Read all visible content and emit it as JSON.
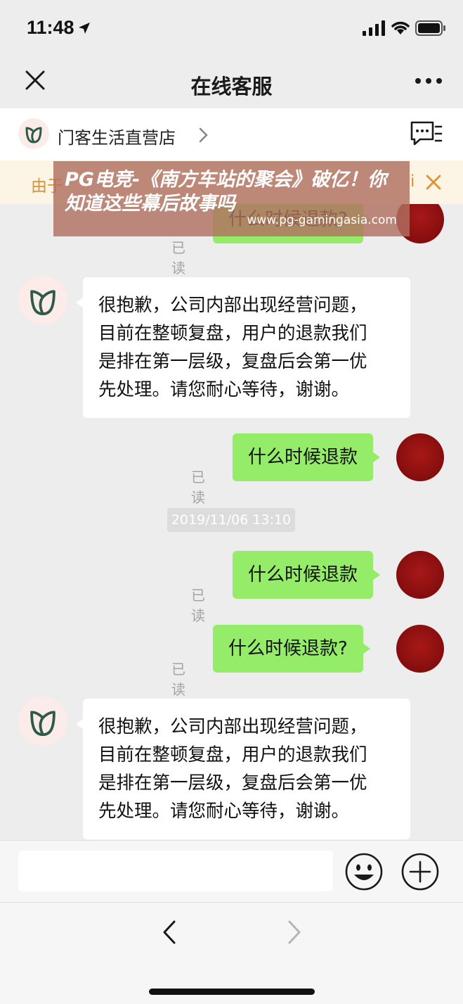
{
  "status_bar": {
    "time": "11:48"
  },
  "nav": {
    "title": "在线客服"
  },
  "shop": {
    "name": "门客生活直营店"
  },
  "notice": {
    "text_start": "由于",
    "text_end": "i"
  },
  "watermark": {
    "title": "PG电竞-《南方车站的聚会》破亿！你知道这些幕后故事吗",
    "url": "www.pg-gamingasia.com"
  },
  "chat": {
    "read_label": "已读",
    "timestamp": "2019/11/06 13:10",
    "messages": [
      {
        "from": "user",
        "text": "什么时候退款?",
        "read": "已读"
      },
      {
        "from": "shop",
        "text": "很抱歉，公司内部出现经营问题，目前在整顿复盘，用户的退款我们是排在第一层级，复盘后会第一优先处理。请您耐心等待，谢谢。"
      },
      {
        "from": "user",
        "text": "什么时候退款",
        "read": "已读"
      },
      {
        "from": "user",
        "text": "什么时候退款",
        "read": "已读"
      },
      {
        "from": "user",
        "text": "什么时候退款?",
        "read": "已读"
      },
      {
        "from": "shop",
        "text": "很抱歉，公司内部出现经营问题，目前在整顿复盘，用户的退款我们是排在第一层级，复盘后会第一优先处理。请您耐心等待，谢谢。"
      }
    ],
    "shop_lines": [
      "很抱歉，公司内部出现经营问题，",
      "目前在整顿复盘，用户的退款我们",
      "是排在第一层级，复盘后会第一优",
      "先处理。请您耐心等待，谢谢。"
    ]
  },
  "input": {
    "placeholder": ""
  },
  "colors": {
    "background": "#ededed",
    "bubble_out": "#95ec69",
    "bubble_in": "#ffffff",
    "notice_text": "#e0922e",
    "brand_green": "#2f5a47"
  },
  "icons": {
    "close": "close-icon",
    "more": "more-icon",
    "chevron": "chevron-right-icon",
    "service": "customer-service-icon",
    "emoji": "emoji-icon",
    "plus": "plus-icon",
    "back": "back-arrow-icon",
    "forward": "forward-arrow-icon"
  }
}
